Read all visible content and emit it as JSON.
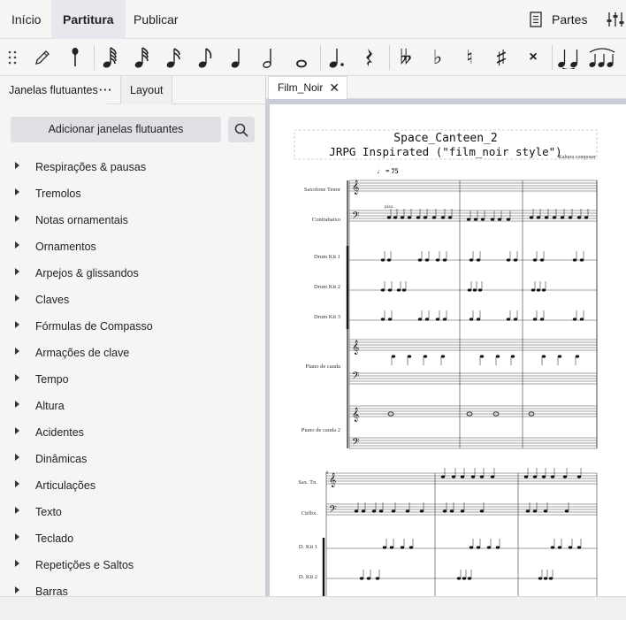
{
  "menu": {
    "tabs": [
      {
        "label": "Início"
      },
      {
        "label": "Partitura"
      },
      {
        "label": "Publicar"
      }
    ],
    "parts_label": "Partes"
  },
  "toolbar": {
    "icons": [
      "grip-icon",
      "pencil-icon",
      "pin-icon",
      "64th-note-icon",
      "32nd-note-icon",
      "16th-note-icon",
      "eighth-note-icon",
      "quarter-note-icon",
      "half-note-icon",
      "whole-note-icon",
      "dotted-note-icon",
      "rest-icon",
      "double-flat-icon",
      "flat-icon",
      "natural-icon",
      "sharp-icon",
      "double-sharp-icon",
      "tie-icon",
      "slur-icon"
    ],
    "glyphs": {
      "double_flat": "𝄫",
      "flat": "♭",
      "natural": "♮",
      "sharp": "♯",
      "double_sharp": "×",
      "dot": ".",
      "rest": "𝄽"
    }
  },
  "panel": {
    "tab_palettes": "Janelas flutuantes",
    "tab_more": "···",
    "tab_layout": "Layout",
    "add_button": "Adicionar janelas flutuantes",
    "items": [
      {
        "label": "Respirações & pausas"
      },
      {
        "label": "Tremolos"
      },
      {
        "label": "Notas ornamentais"
      },
      {
        "label": "Ornamentos"
      },
      {
        "label": "Arpejos & glissandos"
      },
      {
        "label": "Claves"
      },
      {
        "label": "Fórmulas de Compasso"
      },
      {
        "label": "Armações de clave"
      },
      {
        "label": "Tempo"
      },
      {
        "label": "Altura"
      },
      {
        "label": "Acidentes"
      },
      {
        "label": "Dinâmicas"
      },
      {
        "label": "Articulações"
      },
      {
        "label": "Texto"
      },
      {
        "label": "Teclado"
      },
      {
        "label": "Repetições e Saltos"
      },
      {
        "label": "Barras"
      }
    ]
  },
  "document": {
    "tab_label": "Film_Noir",
    "close_glyph": "✕",
    "score": {
      "title": "Space_Canteen_2",
      "subtitle": "JRPG Inspirated (\"film_noir style\")",
      "composer": "Kabura composer",
      "tempo": "♩ = 75",
      "pizz": "pizz.",
      "measure_number": "4",
      "staves": [
        {
          "name": "Saxofone Tenor"
        },
        {
          "name": "Contrabaixo"
        },
        {
          "name": "Drum Kit 1"
        },
        {
          "name": "Drum Kit 2"
        },
        {
          "name": "Drum Kit 3"
        },
        {
          "name": "Piano de cauda"
        },
        {
          "name": "Piano de cauda 2"
        }
      ],
      "staves_short": [
        {
          "name": "Sax. Tn."
        },
        {
          "name": "Ctrlbx."
        },
        {
          "name": "D. Kit 1"
        },
        {
          "name": "D. Kit 2"
        }
      ]
    }
  }
}
